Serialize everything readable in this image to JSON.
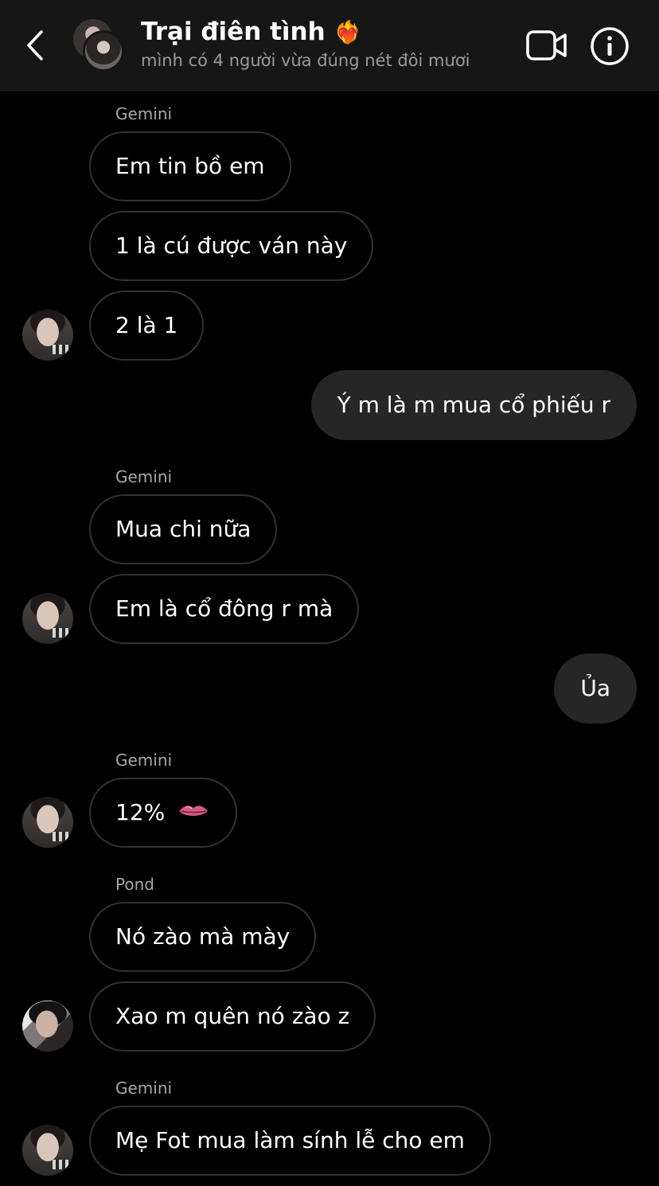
{
  "header": {
    "title": "Trại điên tình",
    "title_emoji": "❤️‍🔥",
    "subtitle": "mình có 4 người vừa đúng nét đôi mươi"
  },
  "messages": [
    {
      "sender_label": "Gemini"
    },
    {
      "text": "Em tin bồ em"
    },
    {
      "text": "1 là cú được ván này"
    },
    {
      "text": "2 là 1"
    },
    {
      "text": "Ý m là m mua cổ phiếu r"
    },
    {
      "sender_label": "Gemini"
    },
    {
      "text": "Mua chi nữa"
    },
    {
      "text": "Em là cổ đông r mà"
    },
    {
      "text": "Ủa"
    },
    {
      "sender_label": "Gemini"
    },
    {
      "text": "12%"
    },
    {
      "sender_label": "Pond"
    },
    {
      "text": "Nó zào mà mày"
    },
    {
      "text": "Xao m quên nó zào z"
    },
    {
      "sender_label": "Gemini"
    },
    {
      "text": "Mẹ Fot mua làm sính lễ cho em"
    }
  ],
  "icons": {
    "back": "chevron-left-icon",
    "video": "video-camera-icon",
    "info": "info-icon",
    "lips": "lips-emoji-icon"
  },
  "colors": {
    "background": "#000000",
    "header_bg": "#161616",
    "outgoing_bubble": "#262626",
    "incoming_border": "#323232",
    "secondary_text": "#9a9a9a"
  }
}
